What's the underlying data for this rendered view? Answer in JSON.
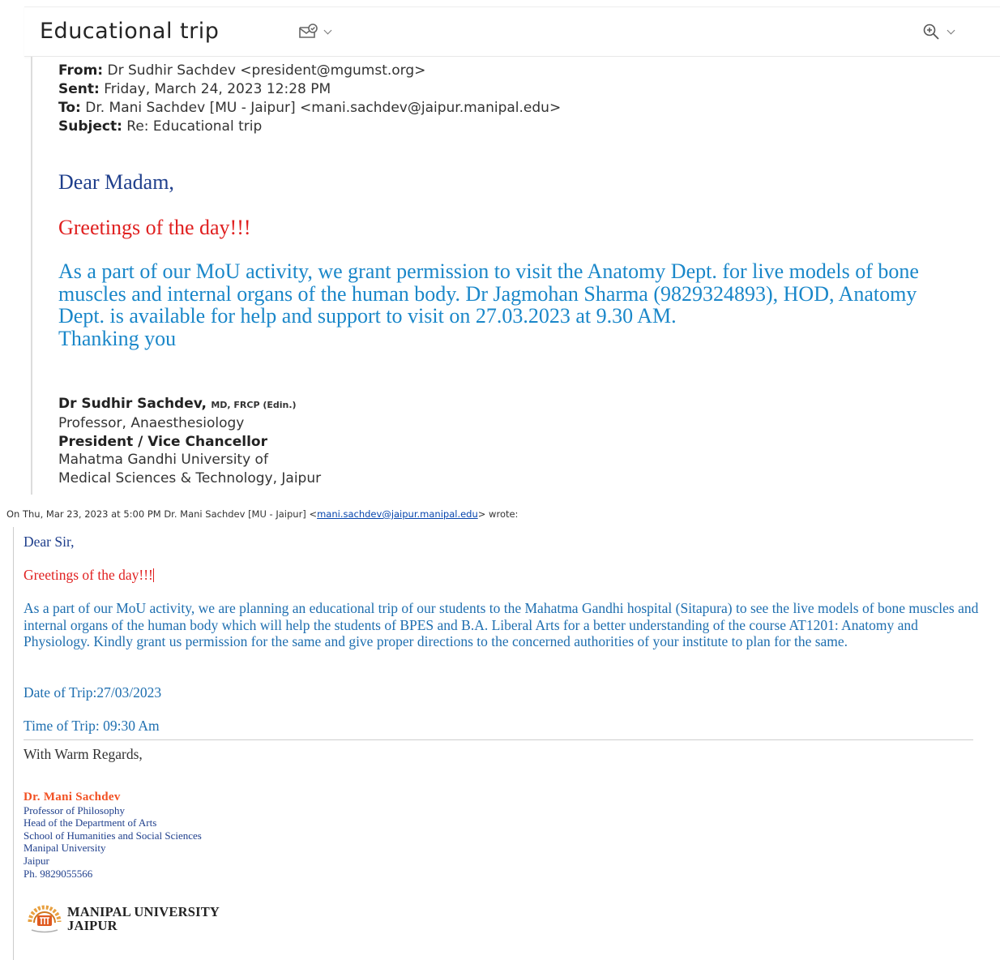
{
  "header": {
    "subject": "Educational trip",
    "summary_icon": "envelope-summary-icon",
    "zoom_icon": "zoom-in-icon"
  },
  "reply": {
    "from_label": "From:",
    "from_value": "Dr Sudhir Sachdev <president@mgumst.org>",
    "sent_label": "Sent:",
    "sent_value": "Friday, March 24, 2023 12:28 PM",
    "to_label": "To:",
    "to_value": "Dr. Mani Sachdev [MU - Jaipur] <mani.sachdev@jaipur.manipal.edu>",
    "subject_label": "Subject:",
    "subject_value": "Re: Educational trip",
    "salutation": "Dear Madam,",
    "greeting": "Greetings of the day!!!",
    "body": "As a part of our MoU activity, we grant permission to visit the Anatomy Dept. for live models of bone muscles and internal organs of the human body. Dr Jagmohan Sharma (9829324893), HOD, Anatomy Dept. is available for help and support to visit on 27.03.2023 at 9.30 AM.",
    "closing": "Thanking you",
    "signature": {
      "name": "Dr Sudhir Sachdev,",
      "credentials": "MD, FRCP (Edin.)",
      "line1": "Professor, Anaesthesiology",
      "line2": "President / Vice Chancellor",
      "line3": "Mahatma Gandhi University of",
      "line4": "Medical Sciences & Technology, Jaipur"
    }
  },
  "quoted": {
    "intro_prefix": "On Thu, Mar 23, 2023 at 5:00 PM Dr. Mani Sachdev [MU - Jaipur] <",
    "intro_email": "mani.sachdev@jaipur.manipal.edu",
    "intro_suffix": "> wrote:",
    "salutation": "Dear Sir,",
    "greeting": "Greetings of the day!!!",
    "body": "As a part of our MoU activity, we are planning an educational trip of our students to the Mahatma Gandhi hospital (Sitapura) to see the live models of bone muscles and internal organs of the human body which will help the students of BPES and B.A. Liberal Arts for a better understanding of the course AT1201: Anatomy and Physiology. Kindly grant us permission for the same and give proper directions to the concerned authorities of your institute to plan for the same.",
    "date_of_trip": "Date of Trip:27/03/2023",
    "time_of_trip": "Time of Trip: 09:30 Am",
    "regards": "With Warm Regards,",
    "signature": {
      "name": "Dr. Mani Sachdev",
      "line1": "Professor of Philosophy",
      "line2": "Head of the Department of Arts",
      "line3": "School of Humanities and Social Sciences",
      "line4": "Manipal University",
      "line5": "Jaipur",
      "phone": "Ph. 9829055566"
    },
    "logo_line1": "MANIPAL UNIVERSITY",
    "logo_line2": "JAIPUR"
  },
  "colors": {
    "salutation": "#1f3f8c",
    "greeting": "#e02020",
    "reply_body": "#1a87c9",
    "quote_body": "#1f6fb0",
    "sig_name": "#f25022",
    "link": "#0645ad"
  }
}
